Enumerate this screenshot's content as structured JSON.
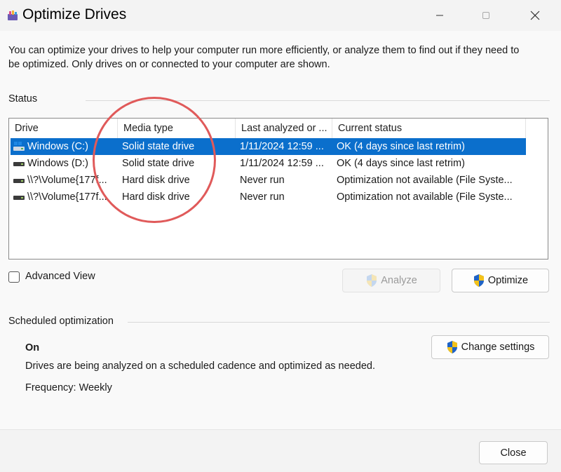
{
  "window": {
    "title": "Optimize Drives",
    "app_icon": "defrag-icon",
    "controls": [
      "minimize-icon",
      "maximize-icon",
      "close-icon"
    ]
  },
  "intro_text": "You can optimize your drives to help your computer run more efficiently, or analyze them to find out if they need to be optimized. Only drives on or connected to your computer are shown.",
  "status": {
    "section_label": "Status",
    "columns": [
      "Drive",
      "Media type",
      "Last analyzed or ...",
      "Current status"
    ],
    "drives": [
      {
        "drive": "Windows (C:)",
        "media_type": "Solid state drive",
        "last_analyzed": "1/11/2024 12:59 ...",
        "current_status": "OK (4 days since last retrim)",
        "icon": "windows-drive-icon",
        "selected": true
      },
      {
        "drive": "Windows (D:)",
        "media_type": "Solid state drive",
        "last_analyzed": "1/11/2024 12:59 ...",
        "current_status": "OK (4 days since last retrim)",
        "icon": "drive-icon",
        "selected": false
      },
      {
        "drive": "\\\\?\\Volume{177f...",
        "media_type": "Hard disk drive",
        "last_analyzed": "Never run",
        "current_status": "Optimization not available (File Syste...",
        "icon": "drive-icon",
        "selected": false
      },
      {
        "drive": "\\\\?\\Volume{177f...",
        "media_type": "Hard disk drive",
        "last_analyzed": "Never run",
        "current_status": "Optimization not available (File Syste...",
        "icon": "drive-icon",
        "selected": false
      }
    ]
  },
  "advanced_view": {
    "label": "Advanced View",
    "checked": false
  },
  "buttons": {
    "analyze": {
      "label": "Analyze",
      "enabled": false
    },
    "optimize": {
      "label": "Optimize",
      "enabled": true
    },
    "change_settings": {
      "label": "Change settings"
    },
    "close": {
      "label": "Close"
    }
  },
  "scheduled": {
    "section_label": "Scheduled optimization",
    "state": "On",
    "description": "Drives are being analyzed on a scheduled cadence and optimized as needed.",
    "frequency": "Frequency: Weekly"
  },
  "colors": {
    "selection": "#0b6fcc",
    "annotation_circle": "#e05a5a",
    "window_bg": "#f3f3f3"
  }
}
